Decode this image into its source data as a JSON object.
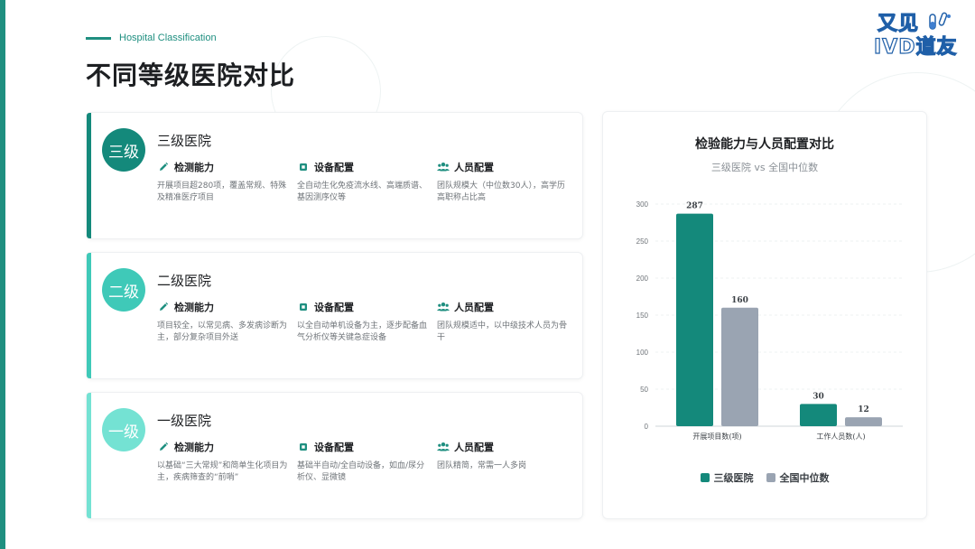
{
  "header": {
    "kicker": "Hospital Classification",
    "title": "不同等级医院对比"
  },
  "logo": {
    "line1": "又见",
    "line2": "IVD道友"
  },
  "colors": {
    "primary": "#1f8f80",
    "level3": "#14897b",
    "level2": "#3fc9b8",
    "level1": "#74e2d3",
    "gray_series": "#9aa4b2"
  },
  "cards": [
    {
      "badge": "三级",
      "title": "三级医院",
      "sections": [
        {
          "icon": "pencil-icon",
          "heading": "检测能力",
          "desc": "开展项目超280项，覆盖常规、特殊及精准医疗项目"
        },
        {
          "icon": "chip-icon",
          "heading": "设备配置",
          "desc": "全自动生化免疫流水线、高端质谱、基因测序仪等"
        },
        {
          "icon": "people-icon",
          "heading": "人员配置",
          "desc": "团队规模大（中位数30人），高学历高职称占比高"
        }
      ]
    },
    {
      "badge": "二级",
      "title": "二级医院",
      "sections": [
        {
          "icon": "pencil-icon",
          "heading": "检测能力",
          "desc": "项目较全，以常见病、多发病诊断为主，部分复杂项目外送"
        },
        {
          "icon": "chip-icon",
          "heading": "设备配置",
          "desc": "以全自动单机设备为主，逐步配备血气分析仪等关键急症设备"
        },
        {
          "icon": "people-icon",
          "heading": "人员配置",
          "desc": "团队规模适中，以中级技术人员为骨干"
        }
      ]
    },
    {
      "badge": "一级",
      "title": "一级医院",
      "sections": [
        {
          "icon": "pencil-icon",
          "heading": "检测能力",
          "desc": "以基础“三大常规”和简单生化项目为主，疾病筛查的“前哨”"
        },
        {
          "icon": "chip-icon",
          "heading": "设备配置",
          "desc": "基础半自动/全自动设备，如血/尿分析仪、显微镜"
        },
        {
          "icon": "people-icon",
          "heading": "人员配置",
          "desc": "团队精简，常需一人多岗"
        }
      ]
    }
  ],
  "chart_data": {
    "type": "bar",
    "title": "检验能力与人员配置对比",
    "subtitle": "三级医院 vs 全国中位数",
    "categories": [
      "开展项目数(项)",
      "工作人员数(人)"
    ],
    "series": [
      {
        "name": "三级医院",
        "values": [
          287,
          30
        ],
        "color": "#14897b"
      },
      {
        "name": "全国中位数",
        "values": [
          160,
          12
        ],
        "color": "#9aa4b2"
      }
    ],
    "ylim": [
      0,
      300
    ],
    "yticks": [
      "0",
      "50",
      "100",
      "150",
      "200",
      "250",
      "300"
    ],
    "grid": true,
    "legend": "bottom",
    "data_labels": true
  }
}
